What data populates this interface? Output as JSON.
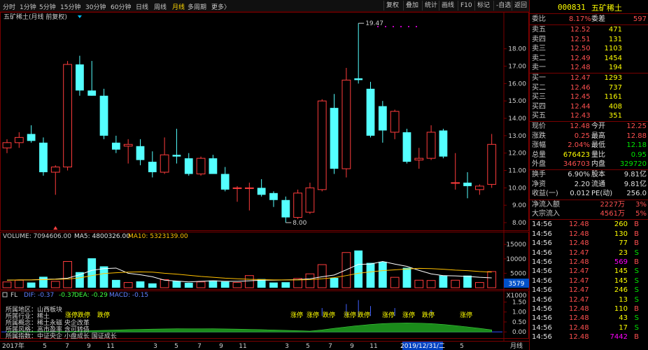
{
  "toolbar": {
    "periods": [
      "分时",
      "1分钟",
      "5分钟",
      "15分钟",
      "30分钟",
      "60分钟",
      "日线",
      "周线",
      "月线",
      "多周期",
      "更多"
    ],
    "active_period": "月线",
    "more_arrow": "〉",
    "buttons": [
      "复权",
      "叠加",
      "统计",
      "画线",
      "F10",
      "标记",
      "-自选",
      "返回"
    ]
  },
  "chart": {
    "title": "五矿稀土(月线 前复权)",
    "high_label": "19.47",
    "low_label": "8.00",
    "volume_legend": {
      "label": "VOLUME: 7094606.00",
      "ma5": "MA5: 4800326.00",
      "ma10": "MA10: 5323139.00"
    },
    "volume_badge": "3579",
    "volume_unit": "X1000",
    "macd_legend": {
      "name": "FL",
      "dif": "DIF: -0.37",
      "dif2": "-0.37",
      "dea": "DEA: -0.29",
      "macd": "MACD: -0.15"
    },
    "info_lines": [
      "所属地区：山西板块",
      "所属行业：稀土",
      "所属概念：稀土永磁 央企改革",
      "所属风格：高市盈率 含可转债",
      "所属指数：中证央企 小盘成长 国证成长"
    ],
    "x_axis": {
      "year_label": "2017年",
      "month_ticks": [
        "5",
        "7",
        "9",
        "11",
        "3",
        "5",
        "7",
        "9",
        "11",
        "3",
        "5",
        "7",
        "9",
        "11",
        "3",
        "5"
      ],
      "cursor_date": "2019/12/31/二",
      "period_label": "月线"
    }
  },
  "chart_data": [
    {
      "type": "candlestick",
      "title": "五矿稀土(月线 前复权)",
      "y_ticks": [
        8,
        9,
        10,
        11,
        12,
        13,
        14,
        15,
        16,
        17,
        18
      ],
      "ylim": [
        7.8,
        19.8
      ],
      "candles": [
        {
          "o": 12.3,
          "h": 12.8,
          "l": 12.0,
          "c": 12.6
        },
        {
          "o": 12.6,
          "h": 13.2,
          "l": 12.3,
          "c": 12.9
        },
        {
          "o": 13.1,
          "h": 13.6,
          "l": 12.6,
          "c": 12.7
        },
        {
          "o": 12.6,
          "h": 12.9,
          "l": 10.7,
          "c": 10.9
        },
        {
          "o": 10.9,
          "h": 11.3,
          "l": 9.6,
          "c": 11.2
        },
        {
          "o": 11.2,
          "h": 17.3,
          "l": 11.0,
          "c": 17.1
        },
        {
          "o": 17.1,
          "h": 17.6,
          "l": 15.3,
          "c": 15.6
        },
        {
          "o": 15.6,
          "h": 17.3,
          "l": 15.3,
          "c": 15.3
        },
        {
          "o": 15.3,
          "h": 15.7,
          "l": 12.8,
          "c": 13.0
        },
        {
          "o": 12.6,
          "h": 13.0,
          "l": 12.0,
          "c": 12.2
        },
        {
          "o": 12.4,
          "h": 12.8,
          "l": 11.4,
          "c": 12.5
        },
        {
          "o": 12.4,
          "h": 12.8,
          "l": 11.3,
          "c": 11.6
        },
        {
          "o": 11.5,
          "h": 12.1,
          "l": 10.6,
          "c": 10.9
        },
        {
          "o": 10.9,
          "h": 12.9,
          "l": 10.8,
          "c": 11.9
        },
        {
          "o": 11.9,
          "h": 13.4,
          "l": 11.4,
          "c": 11.8
        },
        {
          "o": 11.7,
          "h": 12.0,
          "l": 10.7,
          "c": 10.8
        },
        {
          "o": 10.8,
          "h": 11.8,
          "l": 10.7,
          "c": 11.7
        },
        {
          "o": 11.7,
          "h": 11.9,
          "l": 10.8,
          "c": 10.8
        },
        {
          "o": 10.8,
          "h": 11.2,
          "l": 9.8,
          "c": 9.9
        },
        {
          "o": 10.0,
          "h": 10.1,
          "l": 9.2,
          "c": 10.0
        },
        {
          "o": 10.0,
          "h": 10.3,
          "l": 8.7,
          "c": 10.0
        },
        {
          "o": 10.0,
          "h": 10.5,
          "l": 9.5,
          "c": 9.6
        },
        {
          "o": 9.7,
          "h": 9.8,
          "l": 8.9,
          "c": 9.3
        },
        {
          "o": 9.3,
          "h": 9.5,
          "l": 8.0,
          "c": 8.3
        },
        {
          "o": 8.3,
          "h": 9.9,
          "l": 8.2,
          "c": 9.7
        },
        {
          "o": 8.6,
          "h": 10.3,
          "l": 8.5,
          "c": 10.0
        },
        {
          "o": 9.9,
          "h": 15.1,
          "l": 9.8,
          "c": 15.0
        },
        {
          "o": 14.6,
          "h": 15.4,
          "l": 10.8,
          "c": 11.1
        },
        {
          "o": 11.1,
          "h": 16.9,
          "l": 10.6,
          "c": 16.2
        },
        {
          "o": 16.3,
          "h": 19.47,
          "l": 16.0,
          "c": 16.2
        },
        {
          "o": 15.7,
          "h": 16.1,
          "l": 12.9,
          "c": 13.0
        },
        {
          "o": 14.7,
          "h": 15.0,
          "l": 12.6,
          "c": 13.3
        },
        {
          "o": 13.2,
          "h": 14.5,
          "l": 12.8,
          "c": 14.4
        },
        {
          "o": 13.2,
          "h": 13.4,
          "l": 11.4,
          "c": 11.5
        },
        {
          "o": 11.6,
          "h": 12.3,
          "l": 11.1,
          "c": 11.7
        },
        {
          "o": 11.7,
          "h": 13.6,
          "l": 11.6,
          "c": 13.2
        },
        {
          "o": 13.3,
          "h": 13.4,
          "l": 11.7,
          "c": 11.8
        },
        {
          "o": 10.3,
          "h": 12.0,
          "l": 9.9,
          "c": 10.3
        },
        {
          "o": 10.3,
          "h": 10.9,
          "l": 9.4,
          "c": 10.1
        },
        {
          "o": 9.9,
          "h": 10.2,
          "l": 9.6,
          "c": 10.1
        },
        {
          "o": 10.2,
          "h": 13.1,
          "l": 10.0,
          "c": 12.5
        }
      ]
    },
    {
      "type": "bar",
      "title": "VOLUME",
      "y_ticks": [
        5000,
        10000,
        15000
      ],
      "ylim": [
        0,
        16500
      ],
      "values": [
        2000,
        2600,
        1800,
        3800,
        2200,
        9100,
        5400,
        10200,
        7400,
        2700,
        1800,
        2200,
        1500,
        2800,
        2300,
        1700,
        2000,
        2500,
        2100,
        1800,
        4200,
        3000,
        1800,
        1900,
        3200,
        4800,
        8000,
        3400,
        12200,
        12900,
        8600,
        9000,
        3600,
        6900,
        2600,
        2500,
        4200,
        2600,
        4200,
        1800,
        5600
      ],
      "ma5": [
        2600,
        2700,
        2700,
        2900,
        3000,
        3300,
        4500,
        6000,
        6600,
        6800,
        5000,
        4500,
        3800,
        2600,
        2300,
        2000,
        2200,
        2400,
        2200,
        2200,
        2400,
        2600,
        2600,
        2700,
        2800,
        3100,
        3800,
        4400,
        6200,
        8100,
        8200,
        9100,
        8200,
        7400,
        6000,
        4800,
        4200,
        4100,
        3900,
        3600,
        3400
      ],
      "ma10": [
        2600,
        2700,
        2700,
        2800,
        2900,
        3000,
        3400,
        4200,
        4900,
        5200,
        5400,
        5500,
        5400,
        5000,
        4700,
        4300,
        3900,
        3600,
        3300,
        3100,
        2900,
        2800,
        2700,
        2700,
        2700,
        2800,
        3100,
        3500,
        4200,
        5000,
        5500,
        5900,
        6200,
        6500,
        6700,
        6600,
        6400,
        6100,
        5900,
        5600,
        5400
      ]
    },
    {
      "type": "area",
      "title": "FL",
      "y_ticks": [
        0,
        0.5,
        1.0,
        1.5
      ],
      "ylim": [
        -0.1,
        1.8
      ],
      "labels_zt": [
        "涨停",
        "跌停",
        "跌停",
        "涨停",
        "涨停",
        "跌停",
        "涨停",
        "跌停",
        "涨停",
        "涨停",
        "跌停",
        "涨停"
      ]
    }
  ],
  "quote": {
    "code": "000831",
    "name": "五矿稀土",
    "weibi": {
      "label": "委比",
      "value": "8.17%",
      "diff_label": "委差",
      "diff": "597"
    },
    "asks": [
      {
        "label": "卖五",
        "price": "12.52",
        "vol": "471"
      },
      {
        "label": "卖四",
        "price": "12.51",
        "vol": "131"
      },
      {
        "label": "卖三",
        "price": "12.50",
        "vol": "1103"
      },
      {
        "label": "卖二",
        "price": "12.49",
        "vol": "1454"
      },
      {
        "label": "卖一",
        "price": "12.48",
        "vol": "194"
      }
    ],
    "bids": [
      {
        "label": "买一",
        "price": "12.47",
        "vol": "1293"
      },
      {
        "label": "买二",
        "price": "12.46",
        "vol": "737"
      },
      {
        "label": "买三",
        "price": "12.45",
        "vol": "1161"
      },
      {
        "label": "买四",
        "price": "12.44",
        "vol": "408"
      },
      {
        "label": "买五",
        "price": "12.43",
        "vol": "351"
      }
    ],
    "stats": [
      {
        "l1": "现价",
        "v1": "12.48",
        "c1": "red",
        "l2": "今开",
        "v2": "12.25",
        "c2": "red"
      },
      {
        "l1": "涨跌",
        "v1": "0.25",
        "c1": "red",
        "l2": "最高",
        "v2": "12.88",
        "c2": "red"
      },
      {
        "l1": "涨幅",
        "v1": "2.04%",
        "c1": "red",
        "l2": "最低",
        "v2": "12.18",
        "c2": "green"
      },
      {
        "l1": "总量",
        "v1": "676423",
        "c1": "yellow",
        "l2": "量比",
        "v2": "0.95",
        "c2": "green"
      },
      {
        "l1": "外盘",
        "v1": "346703",
        "c1": "red",
        "l2": "内盘",
        "v2": "329720",
        "c2": "green"
      }
    ],
    "stats2": [
      {
        "l1": "换手",
        "v1": "6.90%",
        "c1": "white",
        "l2": "股本",
        "v2": "9.81亿",
        "c2": "white"
      },
      {
        "l1": "净资",
        "v1": "2.20",
        "c1": "white",
        "l2": "流通",
        "v2": "9.81亿",
        "c2": "white"
      },
      {
        "l1": "收益(一)",
        "v1": "0.012",
        "c1": "white",
        "l2": "PE(动)",
        "v2": "256.0",
        "c2": "white"
      }
    ],
    "flows": [
      {
        "label": "净流入额",
        "value": "2227万",
        "pct": "3%"
      },
      {
        "label": "大宗流入",
        "value": "4561万",
        "pct": "5%"
      }
    ],
    "ticks": [
      {
        "time": "14:56",
        "price": "12.48",
        "pc": "red",
        "vol": "260",
        "vc": "yellow",
        "side": "B",
        "sc": "red"
      },
      {
        "time": "14:56",
        "price": "12.48",
        "pc": "red",
        "vol": "130",
        "vc": "yellow",
        "side": "B",
        "sc": "red"
      },
      {
        "time": "14:56",
        "price": "12.48",
        "pc": "red",
        "vol": "77",
        "vc": "yellow",
        "side": "B",
        "sc": "red"
      },
      {
        "time": "14:56",
        "price": "12.47",
        "pc": "red",
        "vol": "23",
        "vc": "yellow",
        "side": "S",
        "sc": "green"
      },
      {
        "time": "14:56",
        "price": "12.48",
        "pc": "red",
        "vol": "569",
        "vc": "mag",
        "side": "B",
        "sc": "red"
      },
      {
        "time": "14:56",
        "price": "12.47",
        "pc": "red",
        "vol": "145",
        "vc": "yellow",
        "side": "S",
        "sc": "green"
      },
      {
        "time": "14:56",
        "price": "12.47",
        "pc": "red",
        "vol": "145",
        "vc": "yellow",
        "side": "S",
        "sc": "green"
      },
      {
        "time": "14:56",
        "price": "12.47",
        "pc": "red",
        "vol": "246",
        "vc": "yellow",
        "side": "S",
        "sc": "green"
      },
      {
        "time": "14:56",
        "price": "12.47",
        "pc": "red",
        "vol": "13",
        "vc": "yellow",
        "side": "S",
        "sc": "green"
      },
      {
        "time": "14:56",
        "price": "12.48",
        "pc": "red",
        "vol": "110",
        "vc": "yellow",
        "side": "B",
        "sc": "red"
      },
      {
        "time": "14:56",
        "price": "12.48",
        "pc": "red",
        "vol": "43",
        "vc": "yellow",
        "side": "S",
        "sc": "green"
      },
      {
        "time": "14:56",
        "price": "12.48",
        "pc": "red",
        "vol": "17",
        "vc": "yellow",
        "side": "S",
        "sc": "green"
      },
      {
        "time": "14:56",
        "price": "12.48",
        "pc": "red",
        "vol": "7442",
        "vc": "mag",
        "side": "B",
        "sc": "red"
      }
    ]
  },
  "colors": {
    "up": "#ff3c3c",
    "down": "#54ffff",
    "bg": "#000000",
    "grid": "#7a0000",
    "ma5": "#ffffff",
    "ma10": "#ffc000"
  }
}
